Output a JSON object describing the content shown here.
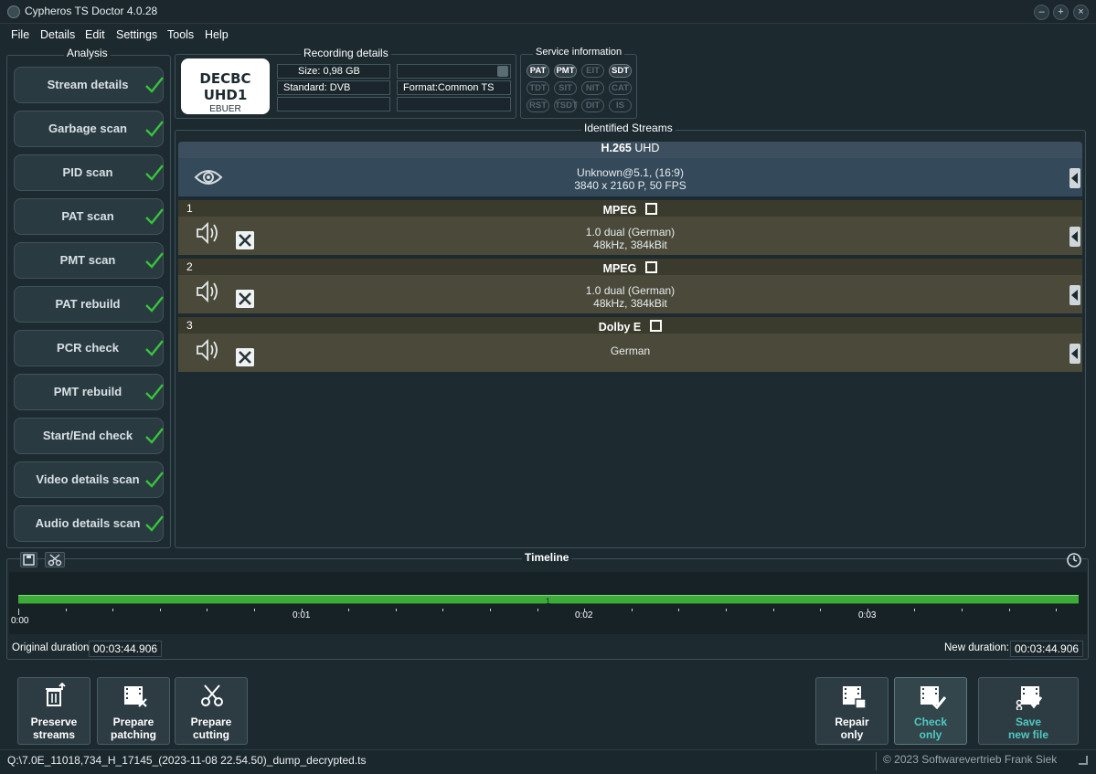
{
  "window": {
    "title": "Cypheros TS Doctor 4.0.28"
  },
  "menu": [
    "File",
    "Details",
    "Edit",
    "Settings",
    "Tools",
    "Help"
  ],
  "analysis": {
    "title": "Analysis",
    "items": [
      "Stream details",
      "Garbage scan",
      "PID scan",
      "PAT scan",
      "PMT scan",
      "PAT rebuild",
      "PCR check",
      "PMT rebuild",
      "Start/End check",
      "Video details scan",
      "Audio details scan"
    ]
  },
  "recording": {
    "title": "Recording details",
    "logo_line1": "DECBC",
    "logo_line2": "UHD1",
    "logo_line3": "EBUER",
    "size": "Size:  0,98 GB",
    "standard": "Standard: DVB",
    "format": "Format:Common TS"
  },
  "service": {
    "title": "Service information",
    "tags": [
      {
        "label": "PAT",
        "active": true
      },
      {
        "label": "PMT",
        "active": true
      },
      {
        "label": "EIT",
        "active": false
      },
      {
        "label": "SDT",
        "active": true
      },
      {
        "label": "TDT",
        "active": false
      },
      {
        "label": "SIT",
        "active": false
      },
      {
        "label": "NIT",
        "active": false
      },
      {
        "label": "CAT",
        "active": false
      },
      {
        "label": "RST",
        "active": false
      },
      {
        "label": "TSDT",
        "active": false
      },
      {
        "label": "DIT",
        "active": false
      },
      {
        "label": "IS",
        "active": false
      }
    ]
  },
  "streams": {
    "title": "Identified Streams",
    "video": {
      "codec": "H.265",
      "quality": "UHD",
      "line1": "Unknown@5.1,  (16:9)",
      "line2": "3840 x 2160 P, 50 FPS"
    },
    "audio": [
      {
        "num": "1",
        "codec": "MPEG",
        "line1": "1.0 dual (German)",
        "line2": "48kHz, 384kBit"
      },
      {
        "num": "2",
        "codec": "MPEG",
        "line1": "1.0 dual (German)",
        "line2": "48kHz, 384kBit"
      },
      {
        "num": "3",
        "codec": "Dolby E",
        "line1": "German",
        "line2": ""
      }
    ]
  },
  "timeline": {
    "title": "Timeline",
    "ticks": [
      "0:00",
      "0:01",
      "0:02",
      "0:03"
    ],
    "original_label": "Original duration:",
    "original_value": "00:03:44.906",
    "new_label": "New duration:",
    "new_value": "00:03:44.906"
  },
  "actions": {
    "preserve": [
      "Preserve",
      "streams"
    ],
    "patching": [
      "Prepare",
      "patching"
    ],
    "cutting": [
      "Prepare",
      "cutting"
    ],
    "repair": [
      "Repair",
      "only"
    ],
    "check": [
      "Check",
      "only"
    ],
    "save": [
      "Save",
      "new file"
    ]
  },
  "status": {
    "path": "Q:\\7.0E_11018,734_H_17145_(2023-11-08 22.54.50)_dump_decrypted.ts",
    "copyright": "© 2023 Softwarevertrieb Frank Siek"
  },
  "colors": {
    "accent": "#4fc9c2",
    "video_row": "#34495a",
    "audio_row": "#4b4a3a",
    "check": "#37c43c",
    "timeline_bar": "#3daa3a"
  }
}
